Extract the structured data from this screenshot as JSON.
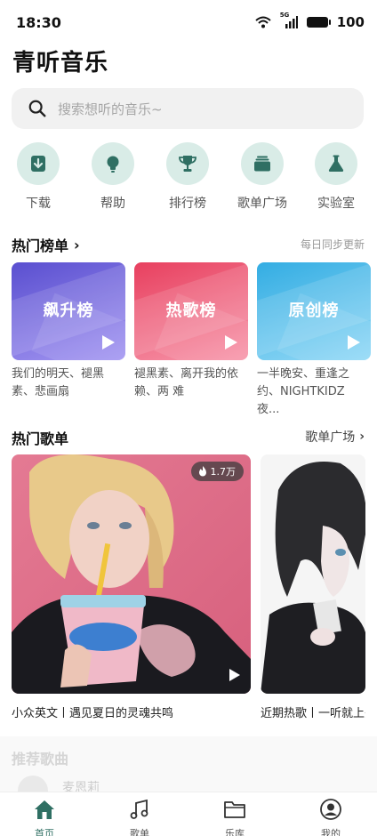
{
  "status_bar": {
    "time": "18:30",
    "network": "5G",
    "battery": "100"
  },
  "app": {
    "title": "青听音乐"
  },
  "search": {
    "placeholder": "搜索想听的音乐~"
  },
  "quick_entries": [
    {
      "label": "下载",
      "icon": "download-icon"
    },
    {
      "label": "帮助",
      "icon": "lightbulb-icon"
    },
    {
      "label": "排行榜",
      "icon": "trophy-icon"
    },
    {
      "label": "歌单广场",
      "icon": "folder-stack-icon"
    },
    {
      "label": "实验室",
      "icon": "flask-icon"
    }
  ],
  "hot_charts": {
    "title": "热门榜单",
    "subtitle": "每日同步更新",
    "cards": [
      {
        "name": "飙升榜",
        "desc": "我们的明天、褪黑素、悲画扇",
        "color_start": "#6a5fd6",
        "color_end": "#a08ff0"
      },
      {
        "name": "热歌榜",
        "desc": "褪黑素、离开我的依赖、两 难",
        "color_start": "#ea4d6a",
        "color_end": "#f58aa0"
      },
      {
        "name": "原创榜",
        "desc": "一半晚安、重逢之约、NIGHTKIDZ夜...",
        "color_start": "#3cb4e6",
        "color_end": "#8fd6f5"
      }
    ]
  },
  "hot_playlists": {
    "title": "热门歌单",
    "more_label": "歌单广场",
    "items": [
      {
        "caption": "小众英文丨遇见夏日的灵魂共鸣",
        "play_count": "1.7万"
      },
      {
        "caption": "近期热歌丨一听就上头"
      }
    ]
  },
  "recommended": {
    "title": "推荐歌曲",
    "song": "麦恩莉"
  },
  "bottom_nav": [
    {
      "label": "首页",
      "icon": "home-icon",
      "active": true
    },
    {
      "label": "歌单",
      "icon": "music-note-icon",
      "active": false
    },
    {
      "label": "乐库",
      "icon": "folder-icon",
      "active": false
    },
    {
      "label": "我的",
      "icon": "user-icon",
      "active": false
    }
  ],
  "colors": {
    "accent": "#2f6f63",
    "icon_bg": "#d9ece7"
  }
}
